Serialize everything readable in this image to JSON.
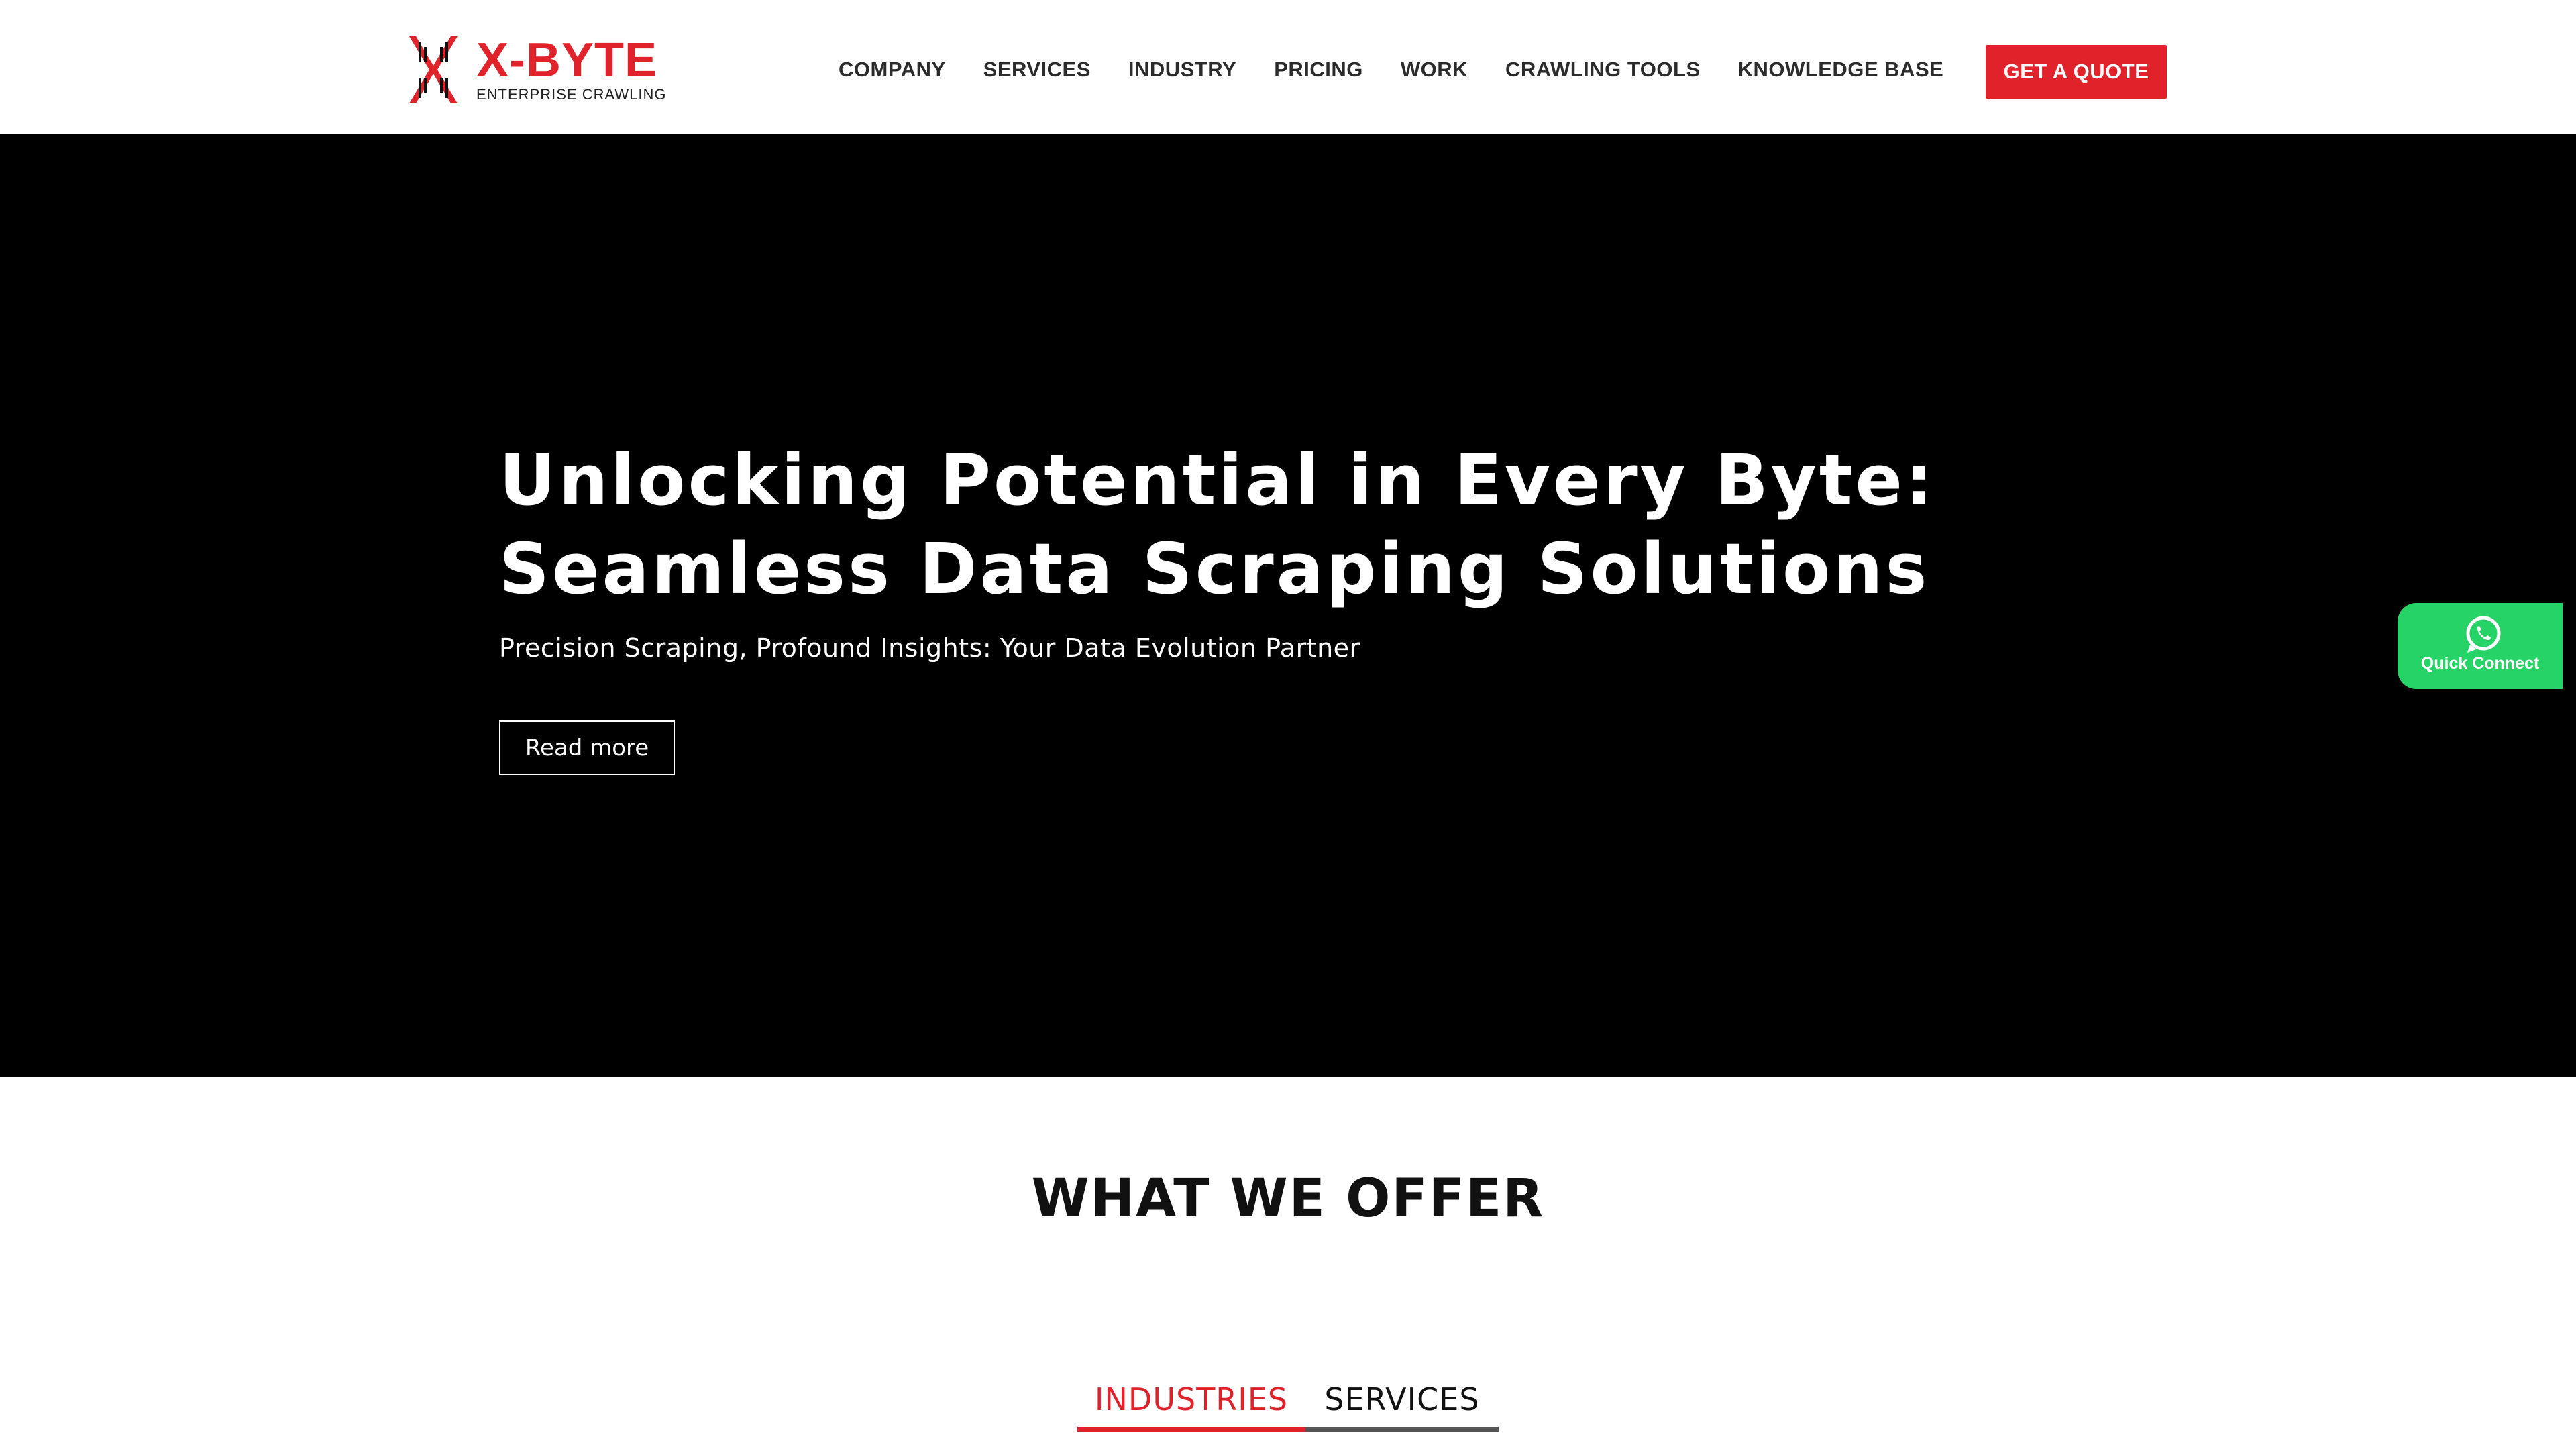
{
  "header": {
    "logo": {
      "name": "X-BYTE",
      "tagline": "ENTERPRISE CRAWLING",
      "icon": "x-byte-logo-mark"
    },
    "nav": [
      {
        "label": "COMPANY"
      },
      {
        "label": "SERVICES"
      },
      {
        "label": "INDUSTRY"
      },
      {
        "label": "PRICING"
      },
      {
        "label": "WORK"
      },
      {
        "label": "CRAWLING TOOLS"
      },
      {
        "label": "KNOWLEDGE BASE"
      }
    ],
    "cta_label": "GET A QUOTE"
  },
  "hero": {
    "title_line1": "Unlocking Potential in Every Byte:",
    "title_line2": "Seamless Data Scraping Solutions",
    "subtitle": "Precision Scraping, Profound Insights: Your Data Evolution Partner",
    "button_label": "Read more"
  },
  "quick_connect": {
    "label": "Quick Connect",
    "icon": "whatsapp-icon"
  },
  "offer": {
    "title": "WHAT WE OFFER",
    "tabs": [
      {
        "label": "INDUSTRIES",
        "active": true
      },
      {
        "label": "SERVICES",
        "active": false
      }
    ]
  },
  "colors": {
    "brand_red": "#e0222a",
    "hero_background": "#000000",
    "whatsapp_green": "#25d366",
    "nav_text": "#2b2b2b"
  }
}
